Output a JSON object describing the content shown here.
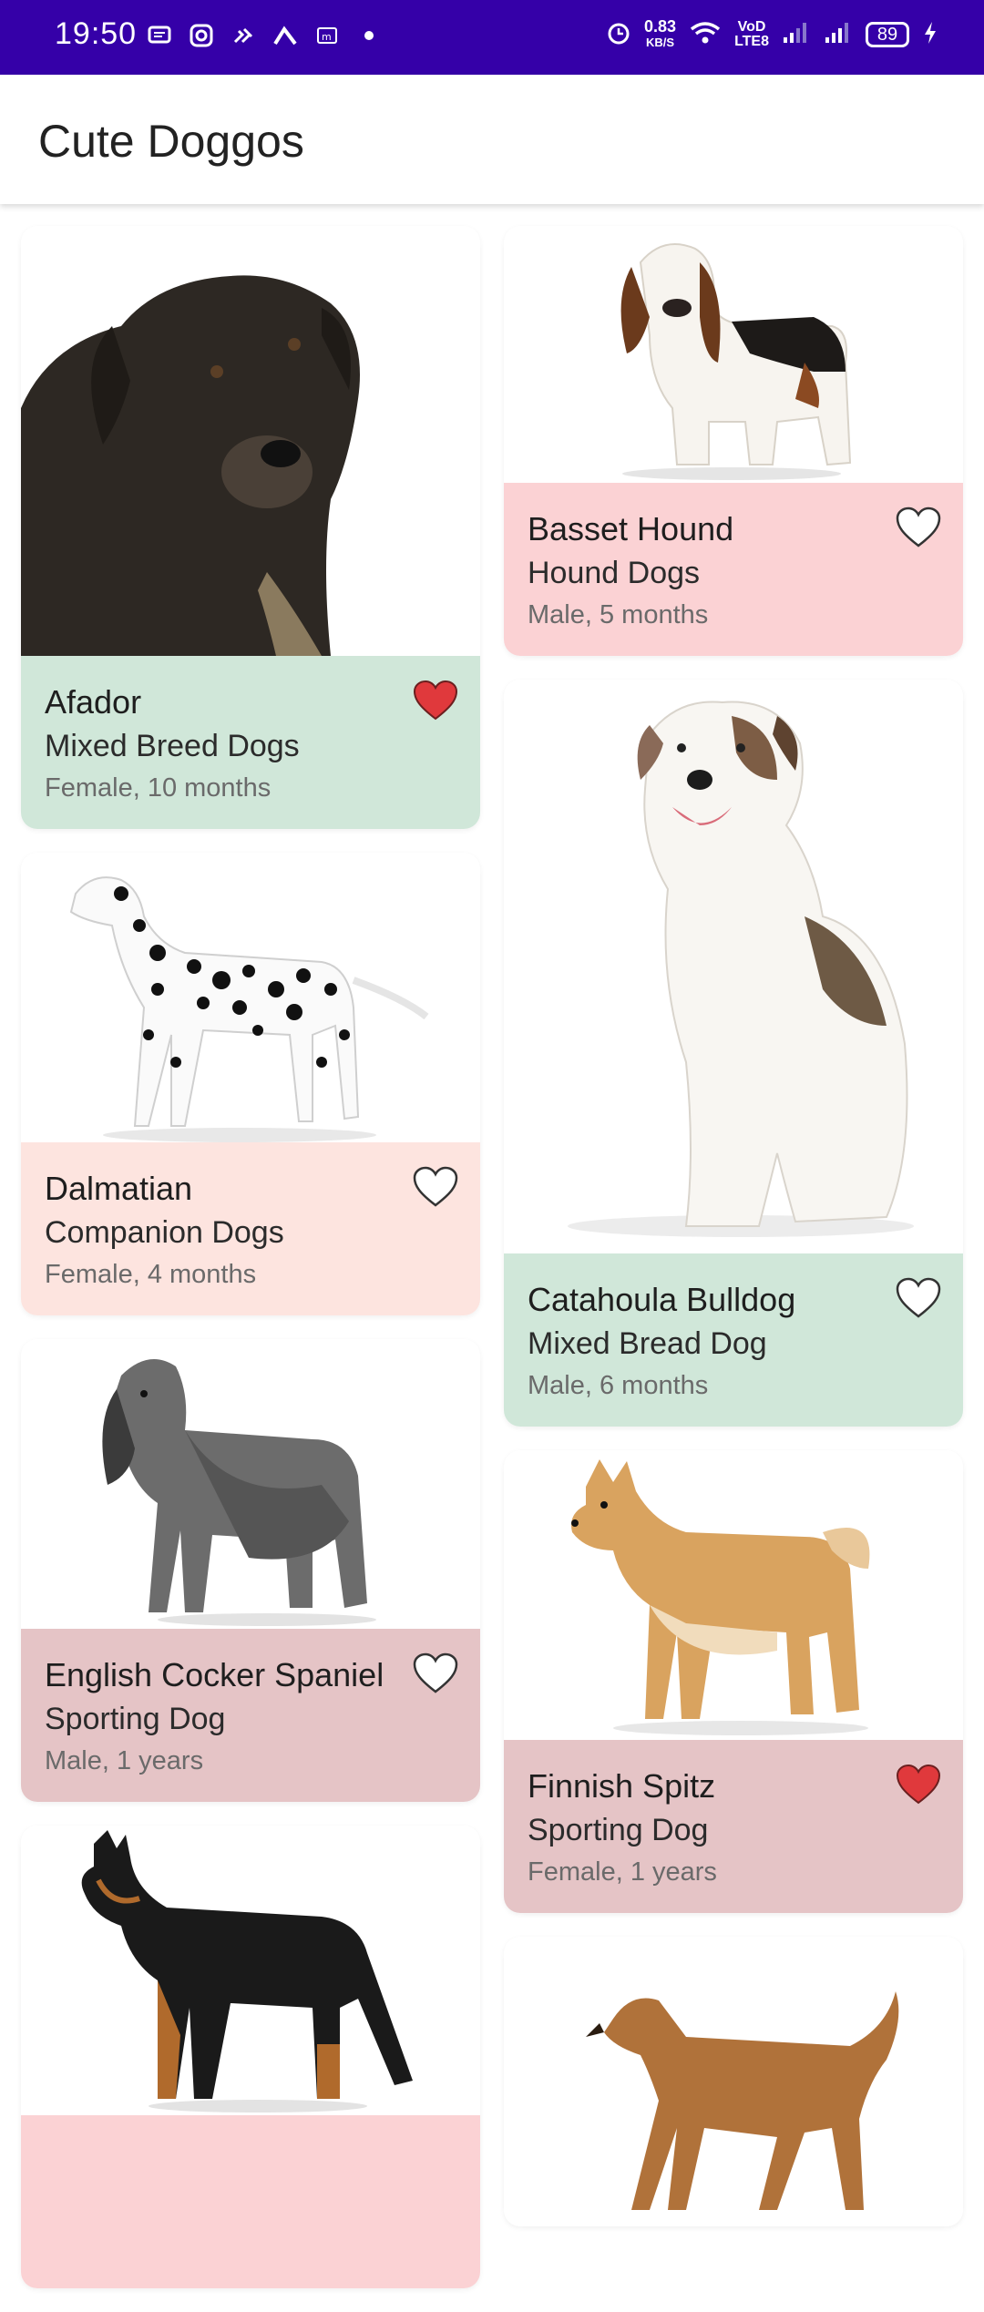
{
  "status_bar": {
    "time": "19:50",
    "speed_value": "0.83",
    "speed_unit": "KB/S",
    "volte_line1": "VoD",
    "volte_line2": "LTE8",
    "battery": "89",
    "left_icons": [
      "message-icon",
      "instagram-icon",
      "network-icon",
      "vpn-icon",
      "mail-icon",
      "dot-icon"
    ],
    "right_icons": [
      "alarm-icon",
      "wifi-icon",
      "signal-icon",
      "signal-icon",
      "charging-icon"
    ]
  },
  "app": {
    "title": "Cute Doggos"
  },
  "colors": {
    "status_bar": "#3500a8",
    "green": "#d0e7d9",
    "pink": "#fbd2d4",
    "peach": "#fde4df",
    "rose": "#e5c4c6",
    "heart_filled": "#e0393c"
  },
  "dogs": [
    {
      "name": "Afador",
      "group": "Mixed Breed Dogs",
      "meta": "Female, 10 months",
      "favorite": true,
      "color": "green"
    },
    {
      "name": "Basset Hound",
      "group": "Hound Dogs",
      "meta": "Male, 5 months",
      "favorite": false,
      "color": "pink"
    },
    {
      "name": "Dalmatian",
      "group": "Companion Dogs",
      "meta": "Female, 4 months",
      "favorite": false,
      "color": "peach"
    },
    {
      "name": "Catahoula Bulldog",
      "group": "Mixed Bread Dog",
      "meta": "Male, 6 months",
      "favorite": false,
      "color": "green"
    },
    {
      "name": "English Cocker Spaniel",
      "group": "Sporting Dog",
      "meta": "Male, 1 years",
      "favorite": false,
      "color": "rose"
    },
    {
      "name": "Finnish Spitz",
      "group": "Sporting Dog",
      "meta": "Female, 1 years",
      "favorite": true,
      "color": "rose"
    }
  ]
}
